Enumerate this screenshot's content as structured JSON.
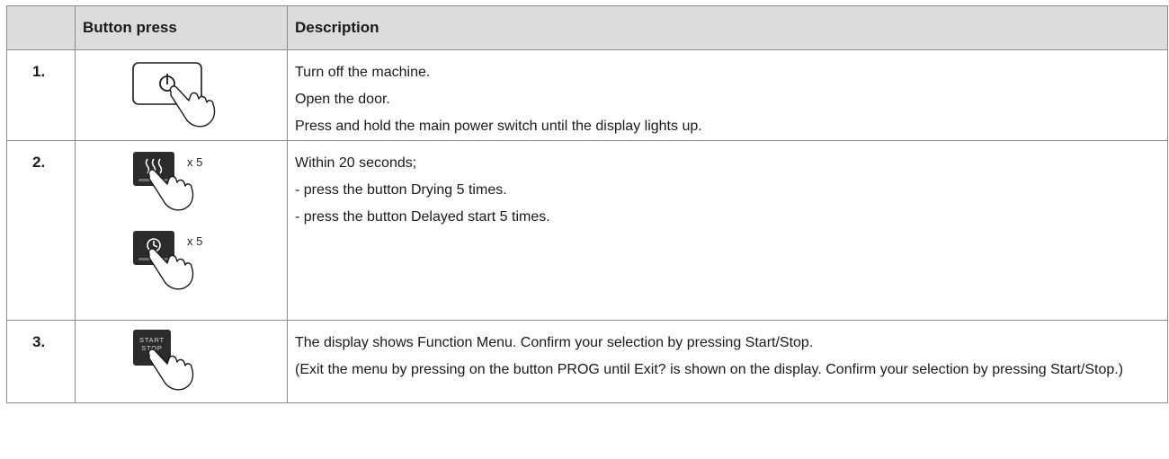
{
  "table": {
    "headers": {
      "step": "",
      "button_press": "Button press",
      "description": "Description"
    },
    "rows": [
      {
        "number": "1.",
        "button": "power-button",
        "lines": [
          "Turn off the machine.",
          "Open the door.",
          "Press and hold the main power switch until the display lights up."
        ]
      },
      {
        "number": "2.",
        "buttons": [
          {
            "button": "drying-button",
            "count": "x 5"
          },
          {
            "button": "delayed-start-button",
            "count": "x 5"
          }
        ],
        "lines": [
          "Within 20 seconds;",
          "- press the button Drying 5 times.",
          "- press the button Delayed start 5 times."
        ]
      },
      {
        "number": "3.",
        "button": "start-stop-button",
        "button_text": [
          "START",
          "STOP"
        ],
        "lines": [
          "The display shows Function Menu. Confirm your selection by pressing Start/Stop.",
          "(Exit the menu by pressing on the button PROG until Exit? is shown on the display. Confirm your selection by pressing Start/Stop.)"
        ]
      }
    ]
  },
  "colors": {
    "header_bg": "#dcdcdc",
    "border": "#8a8a8a",
    "dark_button": "#2b2b2b"
  }
}
